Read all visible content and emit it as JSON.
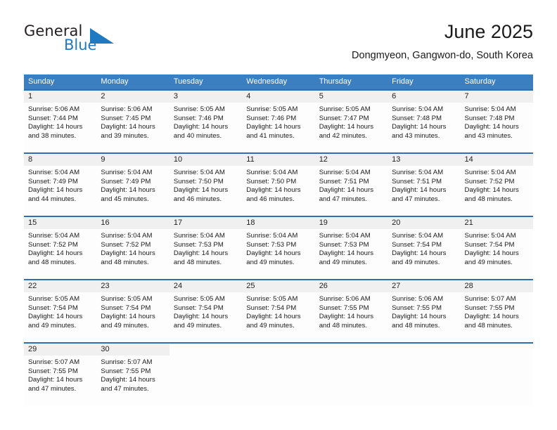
{
  "brand": {
    "word_general": "General",
    "word_blue": "Blue",
    "triangle_color": "#1f7ac4",
    "text_color": "#231f20"
  },
  "header": {
    "title": "June 2025",
    "location": "Dongmyeon, Gangwon-do, South Korea"
  },
  "theme": {
    "header_bg": "#3c7fc0",
    "header_text": "#ffffff",
    "row_divider": "#2f6fb0",
    "daynum_band_bg": "#f0f0f0",
    "cell_bg": "#fdfdfd"
  },
  "calendar": {
    "weekdays": [
      "Sunday",
      "Monday",
      "Tuesday",
      "Wednesday",
      "Thursday",
      "Friday",
      "Saturday"
    ],
    "weeks": [
      [
        {
          "day": "1",
          "sunrise": "Sunrise: 5:06 AM",
          "sunset": "Sunset: 7:44 PM",
          "daylight_1": "Daylight: 14 hours",
          "daylight_2": "and 38 minutes."
        },
        {
          "day": "2",
          "sunrise": "Sunrise: 5:06 AM",
          "sunset": "Sunset: 7:45 PM",
          "daylight_1": "Daylight: 14 hours",
          "daylight_2": "and 39 minutes."
        },
        {
          "day": "3",
          "sunrise": "Sunrise: 5:05 AM",
          "sunset": "Sunset: 7:46 PM",
          "daylight_1": "Daylight: 14 hours",
          "daylight_2": "and 40 minutes."
        },
        {
          "day": "4",
          "sunrise": "Sunrise: 5:05 AM",
          "sunset": "Sunset: 7:46 PM",
          "daylight_1": "Daylight: 14 hours",
          "daylight_2": "and 41 minutes."
        },
        {
          "day": "5",
          "sunrise": "Sunrise: 5:05 AM",
          "sunset": "Sunset: 7:47 PM",
          "daylight_1": "Daylight: 14 hours",
          "daylight_2": "and 42 minutes."
        },
        {
          "day": "6",
          "sunrise": "Sunrise: 5:04 AM",
          "sunset": "Sunset: 7:48 PM",
          "daylight_1": "Daylight: 14 hours",
          "daylight_2": "and 43 minutes."
        },
        {
          "day": "7",
          "sunrise": "Sunrise: 5:04 AM",
          "sunset": "Sunset: 7:48 PM",
          "daylight_1": "Daylight: 14 hours",
          "daylight_2": "and 43 minutes."
        }
      ],
      [
        {
          "day": "8",
          "sunrise": "Sunrise: 5:04 AM",
          "sunset": "Sunset: 7:49 PM",
          "daylight_1": "Daylight: 14 hours",
          "daylight_2": "and 44 minutes."
        },
        {
          "day": "9",
          "sunrise": "Sunrise: 5:04 AM",
          "sunset": "Sunset: 7:49 PM",
          "daylight_1": "Daylight: 14 hours",
          "daylight_2": "and 45 minutes."
        },
        {
          "day": "10",
          "sunrise": "Sunrise: 5:04 AM",
          "sunset": "Sunset: 7:50 PM",
          "daylight_1": "Daylight: 14 hours",
          "daylight_2": "and 46 minutes."
        },
        {
          "day": "11",
          "sunrise": "Sunrise: 5:04 AM",
          "sunset": "Sunset: 7:50 PM",
          "daylight_1": "Daylight: 14 hours",
          "daylight_2": "and 46 minutes."
        },
        {
          "day": "12",
          "sunrise": "Sunrise: 5:04 AM",
          "sunset": "Sunset: 7:51 PM",
          "daylight_1": "Daylight: 14 hours",
          "daylight_2": "and 47 minutes."
        },
        {
          "day": "13",
          "sunrise": "Sunrise: 5:04 AM",
          "sunset": "Sunset: 7:51 PM",
          "daylight_1": "Daylight: 14 hours",
          "daylight_2": "and 47 minutes."
        },
        {
          "day": "14",
          "sunrise": "Sunrise: 5:04 AM",
          "sunset": "Sunset: 7:52 PM",
          "daylight_1": "Daylight: 14 hours",
          "daylight_2": "and 48 minutes."
        }
      ],
      [
        {
          "day": "15",
          "sunrise": "Sunrise: 5:04 AM",
          "sunset": "Sunset: 7:52 PM",
          "daylight_1": "Daylight: 14 hours",
          "daylight_2": "and 48 minutes."
        },
        {
          "day": "16",
          "sunrise": "Sunrise: 5:04 AM",
          "sunset": "Sunset: 7:52 PM",
          "daylight_1": "Daylight: 14 hours",
          "daylight_2": "and 48 minutes."
        },
        {
          "day": "17",
          "sunrise": "Sunrise: 5:04 AM",
          "sunset": "Sunset: 7:53 PM",
          "daylight_1": "Daylight: 14 hours",
          "daylight_2": "and 48 minutes."
        },
        {
          "day": "18",
          "sunrise": "Sunrise: 5:04 AM",
          "sunset": "Sunset: 7:53 PM",
          "daylight_1": "Daylight: 14 hours",
          "daylight_2": "and 49 minutes."
        },
        {
          "day": "19",
          "sunrise": "Sunrise: 5:04 AM",
          "sunset": "Sunset: 7:53 PM",
          "daylight_1": "Daylight: 14 hours",
          "daylight_2": "and 49 minutes."
        },
        {
          "day": "20",
          "sunrise": "Sunrise: 5:04 AM",
          "sunset": "Sunset: 7:54 PM",
          "daylight_1": "Daylight: 14 hours",
          "daylight_2": "and 49 minutes."
        },
        {
          "day": "21",
          "sunrise": "Sunrise: 5:04 AM",
          "sunset": "Sunset: 7:54 PM",
          "daylight_1": "Daylight: 14 hours",
          "daylight_2": "and 49 minutes."
        }
      ],
      [
        {
          "day": "22",
          "sunrise": "Sunrise: 5:05 AM",
          "sunset": "Sunset: 7:54 PM",
          "daylight_1": "Daylight: 14 hours",
          "daylight_2": "and 49 minutes."
        },
        {
          "day": "23",
          "sunrise": "Sunrise: 5:05 AM",
          "sunset": "Sunset: 7:54 PM",
          "daylight_1": "Daylight: 14 hours",
          "daylight_2": "and 49 minutes."
        },
        {
          "day": "24",
          "sunrise": "Sunrise: 5:05 AM",
          "sunset": "Sunset: 7:54 PM",
          "daylight_1": "Daylight: 14 hours",
          "daylight_2": "and 49 minutes."
        },
        {
          "day": "25",
          "sunrise": "Sunrise: 5:05 AM",
          "sunset": "Sunset: 7:54 PM",
          "daylight_1": "Daylight: 14 hours",
          "daylight_2": "and 49 minutes."
        },
        {
          "day": "26",
          "sunrise": "Sunrise: 5:06 AM",
          "sunset": "Sunset: 7:55 PM",
          "daylight_1": "Daylight: 14 hours",
          "daylight_2": "and 48 minutes."
        },
        {
          "day": "27",
          "sunrise": "Sunrise: 5:06 AM",
          "sunset": "Sunset: 7:55 PM",
          "daylight_1": "Daylight: 14 hours",
          "daylight_2": "and 48 minutes."
        },
        {
          "day": "28",
          "sunrise": "Sunrise: 5:07 AM",
          "sunset": "Sunset: 7:55 PM",
          "daylight_1": "Daylight: 14 hours",
          "daylight_2": "and 48 minutes."
        }
      ],
      [
        {
          "day": "29",
          "sunrise": "Sunrise: 5:07 AM",
          "sunset": "Sunset: 7:55 PM",
          "daylight_1": "Daylight: 14 hours",
          "daylight_2": "and 47 minutes."
        },
        {
          "day": "30",
          "sunrise": "Sunrise: 5:07 AM",
          "sunset": "Sunset: 7:55 PM",
          "daylight_1": "Daylight: 14 hours",
          "daylight_2": "and 47 minutes."
        },
        {
          "day": "",
          "sunrise": "",
          "sunset": "",
          "daylight_1": "",
          "daylight_2": ""
        },
        {
          "day": "",
          "sunrise": "",
          "sunset": "",
          "daylight_1": "",
          "daylight_2": ""
        },
        {
          "day": "",
          "sunrise": "",
          "sunset": "",
          "daylight_1": "",
          "daylight_2": ""
        },
        {
          "day": "",
          "sunrise": "",
          "sunset": "",
          "daylight_1": "",
          "daylight_2": ""
        },
        {
          "day": "",
          "sunrise": "",
          "sunset": "",
          "daylight_1": "",
          "daylight_2": ""
        }
      ]
    ]
  }
}
